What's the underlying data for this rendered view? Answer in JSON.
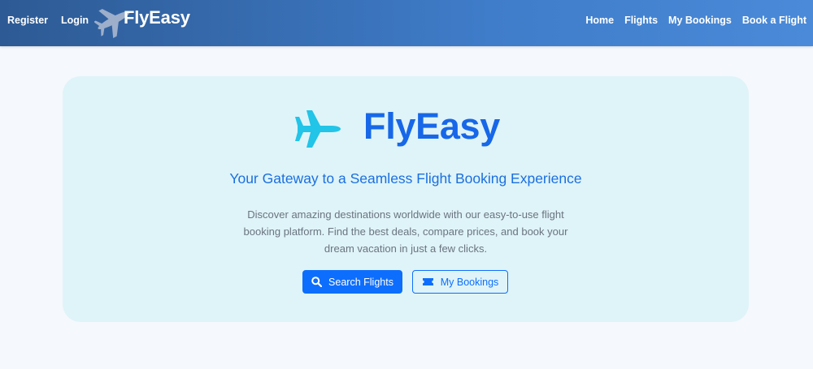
{
  "nav": {
    "left_links": [
      "Register",
      "Login"
    ],
    "brand": "FlyEasy",
    "right_links": [
      "Home",
      "Flights",
      "My Bookings",
      "Book a Flight"
    ]
  },
  "hero": {
    "title": "FlyEasy",
    "subtitle": "Your Gateway to a Seamless Flight Booking Experience",
    "description": "Discover amazing destinations worldwide with our easy-to-use flight booking platform. Find the best deals, compare prices, and book your dream vacation in just a few clicks.",
    "primary_button": "Search Flights",
    "secondary_button": "My Bookings"
  },
  "icons": {
    "brand": "airplane-icon",
    "hero": "airplane-icon",
    "search": "search-icon",
    "ticket": "ticket-icon"
  },
  "colors": {
    "nav_gradient_start": "#2d5a94",
    "nav_gradient_end": "#4a8ad8",
    "accent": "#0d6efd",
    "hero_bg": "#dff4f8",
    "plane": "#22c4e8"
  }
}
